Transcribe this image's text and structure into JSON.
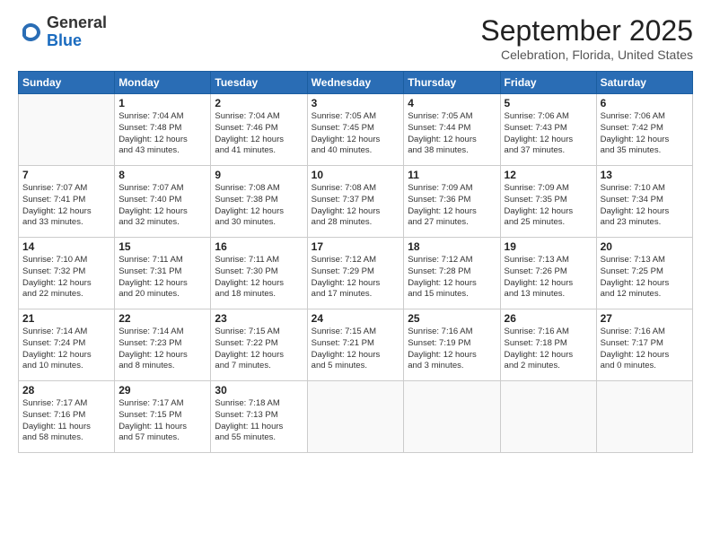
{
  "logo": {
    "general": "General",
    "blue": "Blue"
  },
  "title": "September 2025",
  "subtitle": "Celebration, Florida, United States",
  "headers": [
    "Sunday",
    "Monday",
    "Tuesday",
    "Wednesday",
    "Thursday",
    "Friday",
    "Saturday"
  ],
  "weeks": [
    [
      {
        "day": "",
        "info": ""
      },
      {
        "day": "1",
        "info": "Sunrise: 7:04 AM\nSunset: 7:48 PM\nDaylight: 12 hours\nand 43 minutes."
      },
      {
        "day": "2",
        "info": "Sunrise: 7:04 AM\nSunset: 7:46 PM\nDaylight: 12 hours\nand 41 minutes."
      },
      {
        "day": "3",
        "info": "Sunrise: 7:05 AM\nSunset: 7:45 PM\nDaylight: 12 hours\nand 40 minutes."
      },
      {
        "day": "4",
        "info": "Sunrise: 7:05 AM\nSunset: 7:44 PM\nDaylight: 12 hours\nand 38 minutes."
      },
      {
        "day": "5",
        "info": "Sunrise: 7:06 AM\nSunset: 7:43 PM\nDaylight: 12 hours\nand 37 minutes."
      },
      {
        "day": "6",
        "info": "Sunrise: 7:06 AM\nSunset: 7:42 PM\nDaylight: 12 hours\nand 35 minutes."
      }
    ],
    [
      {
        "day": "7",
        "info": "Sunrise: 7:07 AM\nSunset: 7:41 PM\nDaylight: 12 hours\nand 33 minutes."
      },
      {
        "day": "8",
        "info": "Sunrise: 7:07 AM\nSunset: 7:40 PM\nDaylight: 12 hours\nand 32 minutes."
      },
      {
        "day": "9",
        "info": "Sunrise: 7:08 AM\nSunset: 7:38 PM\nDaylight: 12 hours\nand 30 minutes."
      },
      {
        "day": "10",
        "info": "Sunrise: 7:08 AM\nSunset: 7:37 PM\nDaylight: 12 hours\nand 28 minutes."
      },
      {
        "day": "11",
        "info": "Sunrise: 7:09 AM\nSunset: 7:36 PM\nDaylight: 12 hours\nand 27 minutes."
      },
      {
        "day": "12",
        "info": "Sunrise: 7:09 AM\nSunset: 7:35 PM\nDaylight: 12 hours\nand 25 minutes."
      },
      {
        "day": "13",
        "info": "Sunrise: 7:10 AM\nSunset: 7:34 PM\nDaylight: 12 hours\nand 23 minutes."
      }
    ],
    [
      {
        "day": "14",
        "info": "Sunrise: 7:10 AM\nSunset: 7:32 PM\nDaylight: 12 hours\nand 22 minutes."
      },
      {
        "day": "15",
        "info": "Sunrise: 7:11 AM\nSunset: 7:31 PM\nDaylight: 12 hours\nand 20 minutes."
      },
      {
        "day": "16",
        "info": "Sunrise: 7:11 AM\nSunset: 7:30 PM\nDaylight: 12 hours\nand 18 minutes."
      },
      {
        "day": "17",
        "info": "Sunrise: 7:12 AM\nSunset: 7:29 PM\nDaylight: 12 hours\nand 17 minutes."
      },
      {
        "day": "18",
        "info": "Sunrise: 7:12 AM\nSunset: 7:28 PM\nDaylight: 12 hours\nand 15 minutes."
      },
      {
        "day": "19",
        "info": "Sunrise: 7:13 AM\nSunset: 7:26 PM\nDaylight: 12 hours\nand 13 minutes."
      },
      {
        "day": "20",
        "info": "Sunrise: 7:13 AM\nSunset: 7:25 PM\nDaylight: 12 hours\nand 12 minutes."
      }
    ],
    [
      {
        "day": "21",
        "info": "Sunrise: 7:14 AM\nSunset: 7:24 PM\nDaylight: 12 hours\nand 10 minutes."
      },
      {
        "day": "22",
        "info": "Sunrise: 7:14 AM\nSunset: 7:23 PM\nDaylight: 12 hours\nand 8 minutes."
      },
      {
        "day": "23",
        "info": "Sunrise: 7:15 AM\nSunset: 7:22 PM\nDaylight: 12 hours\nand 7 minutes."
      },
      {
        "day": "24",
        "info": "Sunrise: 7:15 AM\nSunset: 7:21 PM\nDaylight: 12 hours\nand 5 minutes."
      },
      {
        "day": "25",
        "info": "Sunrise: 7:16 AM\nSunset: 7:19 PM\nDaylight: 12 hours\nand 3 minutes."
      },
      {
        "day": "26",
        "info": "Sunrise: 7:16 AM\nSunset: 7:18 PM\nDaylight: 12 hours\nand 2 minutes."
      },
      {
        "day": "27",
        "info": "Sunrise: 7:16 AM\nSunset: 7:17 PM\nDaylight: 12 hours\nand 0 minutes."
      }
    ],
    [
      {
        "day": "28",
        "info": "Sunrise: 7:17 AM\nSunset: 7:16 PM\nDaylight: 11 hours\nand 58 minutes."
      },
      {
        "day": "29",
        "info": "Sunrise: 7:17 AM\nSunset: 7:15 PM\nDaylight: 11 hours\nand 57 minutes."
      },
      {
        "day": "30",
        "info": "Sunrise: 7:18 AM\nSunset: 7:13 PM\nDaylight: 11 hours\nand 55 minutes."
      },
      {
        "day": "",
        "info": ""
      },
      {
        "day": "",
        "info": ""
      },
      {
        "day": "",
        "info": ""
      },
      {
        "day": "",
        "info": ""
      }
    ]
  ]
}
